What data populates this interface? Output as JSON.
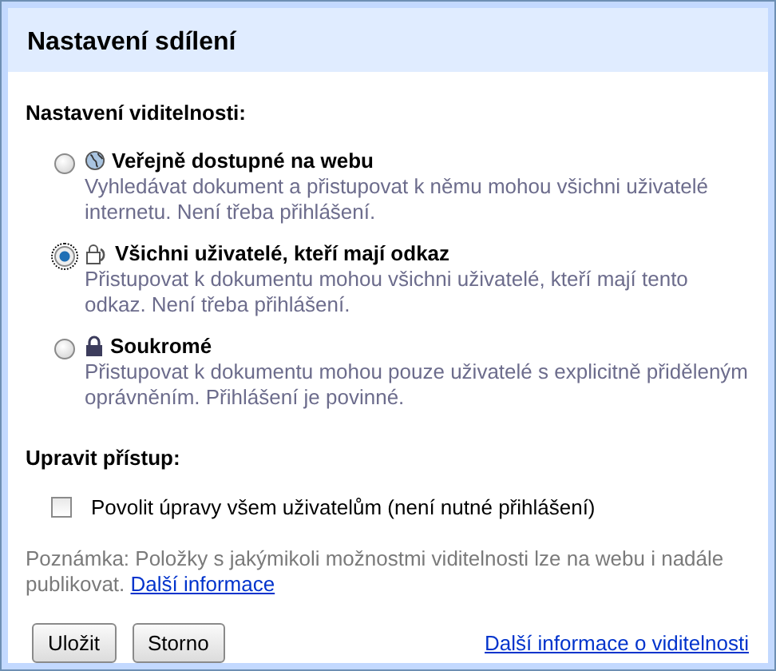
{
  "dialog": {
    "title": "Nastavení sdílení"
  },
  "visibility": {
    "heading": "Nastavení viditelnosti:",
    "options": [
      {
        "kind": "globe",
        "label": "Veřejně dostupné na webu",
        "description": "Vyhledávat dokument a přistupovat k němu mohou všichni uživatelé internetu. Není třeba přihlášení.",
        "selected": false
      },
      {
        "kind": "link",
        "label": "Všichni uživatelé, kteří mají odkaz",
        "description": "Přistupovat k dokumentu mohou všichni uživatelé, kteří mají tento odkaz. Není třeba přihlášení.",
        "selected": true
      },
      {
        "kind": "lock",
        "label": "Soukromé",
        "description": "Přistupovat k dokumentu mohou pouze uživatelé s explicitně přiděleným oprávněním. Přihlášení je povinné.",
        "selected": false
      }
    ]
  },
  "access": {
    "heading": "Upravit přístup:",
    "checkbox": {
      "label": "Povolit úpravy všem uživatelům (není nutné přihlášení)",
      "checked": false
    }
  },
  "note": {
    "text": "Poznámka: Položky s jakýmikoli možnostmi viditelnosti lze na webu i nadále publikovat.",
    "link": "Další informace"
  },
  "buttons": [
    "Uložit",
    "Storno"
  ],
  "footer_link": "Další informace o viditelnosti"
}
